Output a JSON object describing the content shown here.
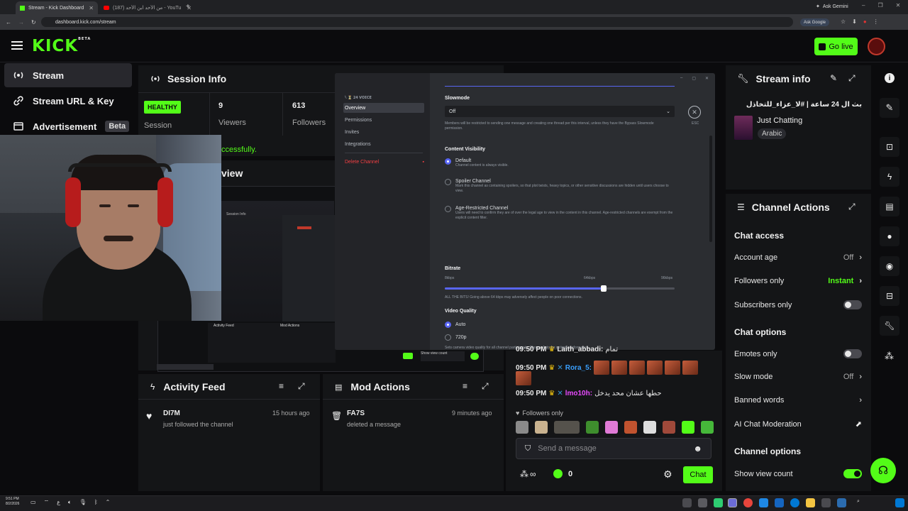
{
  "browser": {
    "tabs": [
      {
        "label": "Stream - Kick Dashboard",
        "active": true
      },
      {
        "label": "(187) من الأحد ابن الأحد - YouTube",
        "active": false
      }
    ],
    "ask_gemini": "Ask Gemini",
    "url": "dashboard.kick.com/stream",
    "ask_google": "Ask Google"
  },
  "header": {
    "logo": "KICK",
    "logo_sup": "BETA",
    "go_live": "Go live"
  },
  "sidebar": {
    "items": [
      {
        "label": "Stream",
        "icon": "stream-icon"
      },
      {
        "label": "Stream URL & Key",
        "icon": "link-icon"
      },
      {
        "label": "Advertisement",
        "icon": "ad-icon",
        "badge": "Beta"
      }
    ]
  },
  "session": {
    "title": "Session Info",
    "status": "HEALTHY",
    "status_label": "Session",
    "viewers_num": "9",
    "viewers_label": "Viewers",
    "followers_num": "613",
    "followers_label": "Followers",
    "success_text": "ccessfully.",
    "preview_fragment": "view"
  },
  "discord": {
    "server_name": "𓆩 ⏳ 𝟮𝟰 𝗩𝗢𝗜𝗖𝗘",
    "nav": [
      "Overview",
      "Permissions",
      "Invites",
      "Integrations"
    ],
    "delete_channel": "Delete Channel",
    "esc": "ESC",
    "slowmode": {
      "label": "Slowmode",
      "value": "Off",
      "help": "Members will be restricted to sending one message and creating one thread per this interval, unless they have the Bypass Slowmode permission."
    },
    "content_visibility": {
      "label": "Content Visibility",
      "options": [
        {
          "title": "Default",
          "desc": "Channel content is always visible.",
          "selected": true
        },
        {
          "title": "Spoiler Channel",
          "desc": "Mark this channel as containing spoilers, so that plot twists, heavy topics, or other sensitive discussions are hidden until users choose to view.",
          "selected": false
        },
        {
          "title": "Age-Restricted Channel",
          "desc": "Users will need to confirm they are of over the legal age to view in the content in this channel. Age-restricted channels are exempt from the explicit content filter.",
          "selected": false
        }
      ]
    },
    "bitrate": {
      "label": "Bitrate",
      "min": "8kbps",
      "mid": "64kbps",
      "max": "96kbps",
      "value_fraction": 0.69,
      "help": "ALL THE BITS! Going above 64 kbps may adversely affect people on poor connections."
    },
    "video_quality": {
      "label": "Video Quality",
      "options": [
        {
          "title": "Auto",
          "selected": true
        },
        {
          "title": "720p",
          "selected": false
        }
      ],
      "help": "Sets camera video quality for all channel participants. Choose Auto for optimal performance."
    }
  },
  "activity": {
    "title": "Activity Feed",
    "user": "DI7M",
    "action": "just followed the channel",
    "time": "15 hours ago"
  },
  "mod": {
    "title": "Mod Actions",
    "user": "FA7S",
    "action": "deleted a message",
    "time": "9 minutes ago"
  },
  "stream_info": {
    "title": "Stream info",
    "stream_title": "بث ال 24 ساعة | #لا_عزاء_للتخاذل",
    "category": "Just Chatting",
    "language": "Arabic"
  },
  "channel_actions": {
    "title": "Channel Actions",
    "chat_access": "Chat access",
    "account_age": "Account age",
    "account_age_val": "Off",
    "followers_only": "Followers only",
    "followers_only_val": "Instant",
    "subscribers_only": "Subscribers only",
    "chat_options": "Chat options",
    "emotes_only": "Emotes only",
    "slow_mode": "Slow mode",
    "slow_mode_val": "Off",
    "banned_words": "Banned words",
    "ai_moderation": "AI Chat Moderation",
    "channel_options": "Channel options",
    "show_view_count": "Show view count"
  },
  "chat": {
    "lines": [
      {
        "time": "09:50 PM",
        "user": "Laith_abbadi:",
        "text": "تمام"
      },
      {
        "time": "09:50 PM",
        "user": "Rora_5:",
        "text": ""
      },
      {
        "time": "09:50 PM",
        "user": "lmo10h:",
        "text": "حطها عشان محد يدخل"
      }
    ],
    "followers_only": "Followers only",
    "placeholder": "Send a message",
    "viewer_count": "0",
    "chat_button": "Chat",
    "infinity": "∞"
  },
  "taskbar": {
    "time": "9:51 PM",
    "date": "8/2/2026",
    "lang": "ع"
  },
  "colors": {
    "brand": "#53fc18",
    "panel": "#141517",
    "discord_accent": "#5865f2",
    "danger": "#f23f43"
  }
}
